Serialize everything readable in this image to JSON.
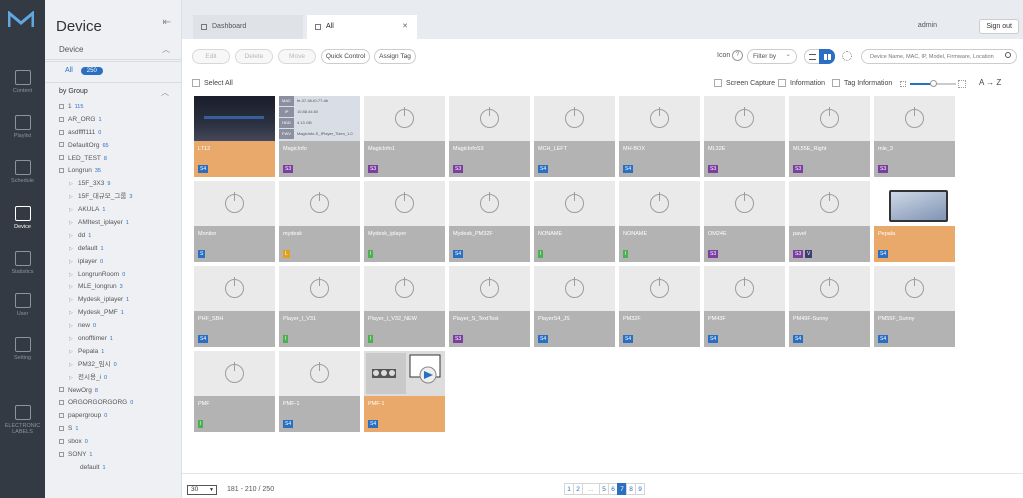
{
  "app": {
    "logo_text": "M"
  },
  "nav": [
    {
      "label": "Content",
      "icon": "content-icon"
    },
    {
      "label": "Playlist",
      "icon": "playlist-icon"
    },
    {
      "label": "Schedule",
      "icon": "schedule-icon"
    },
    {
      "label": "Device",
      "icon": "device-icon",
      "active": true
    },
    {
      "label": "Statistics",
      "icon": "statistics-icon"
    },
    {
      "label": "User",
      "icon": "user-icon"
    },
    {
      "label": "Setting",
      "icon": "setting-icon"
    },
    {
      "label": "ELECTRONIC LABELS",
      "icon": "electronic-labels-icon"
    }
  ],
  "sidebar": {
    "title": "Device",
    "section": "Device",
    "all_label": "All",
    "all_count": "250",
    "by_group": "by Group",
    "tree": [
      {
        "name": "1",
        "count": "115",
        "level": 0
      },
      {
        "name": "AR_ORG",
        "count": "1",
        "level": 0
      },
      {
        "name": "asdffff111",
        "count": "0",
        "level": 0
      },
      {
        "name": "DefaultOrg",
        "count": "65",
        "level": 0
      },
      {
        "name": "LED_TEST",
        "count": "8",
        "level": 0
      },
      {
        "name": "Longrun",
        "count": "35",
        "level": 0
      },
      {
        "name": "15F_3X3",
        "count": "9",
        "level": 1
      },
      {
        "name": "15F_대규모_그룹",
        "count": "3",
        "level": 1
      },
      {
        "name": "AKULA",
        "count": "1",
        "level": 1
      },
      {
        "name": "AMItest_iplayer",
        "count": "1",
        "level": 1
      },
      {
        "name": "dd",
        "count": "1",
        "level": 1
      },
      {
        "name": "default",
        "count": "1",
        "level": 1
      },
      {
        "name": "iplayer",
        "count": "0",
        "level": 1
      },
      {
        "name": "LongrunRoom",
        "count": "0",
        "level": 1
      },
      {
        "name": "MLE_longrun",
        "count": "3",
        "level": 1
      },
      {
        "name": "Mydesk_iplayer",
        "count": "1",
        "level": 1
      },
      {
        "name": "Mydesk_PMF",
        "count": "1",
        "level": 1
      },
      {
        "name": "new",
        "count": "0",
        "level": 1
      },
      {
        "name": "onofftimer",
        "count": "1",
        "level": 1
      },
      {
        "name": "Pepala",
        "count": "1",
        "level": 1
      },
      {
        "name": "PM32_임시",
        "count": "0",
        "level": 1
      },
      {
        "name": "전시용_i",
        "count": "0",
        "level": 1
      },
      {
        "name": "NewOrg",
        "count": "8",
        "level": 0
      },
      {
        "name": "ORGORGORGORG",
        "count": "0",
        "level": 0
      },
      {
        "name": "papergroup",
        "count": "0",
        "level": 0
      },
      {
        "name": "S",
        "count": "1",
        "level": 0
      },
      {
        "name": "sbox",
        "count": "0",
        "level": 0
      },
      {
        "name": "SONY",
        "count": "1",
        "level": 0
      },
      {
        "name": "default",
        "count": "1",
        "level": 2
      }
    ]
  },
  "tabs": [
    {
      "label": "Dashboard"
    },
    {
      "label": "All"
    }
  ],
  "header": {
    "user": "admin",
    "signout": "Sign out"
  },
  "toolbar": {
    "edit": "Edit",
    "delete": "Delete",
    "move": "Move",
    "quick_control": "Quick Control",
    "assign_tag": "Assign Tag",
    "icon_label": "Icon",
    "help": "?",
    "filter": "Filter by",
    "search_placeholder": "Device Name, MAC, IP, Model, Firmware, Location"
  },
  "selectbar": {
    "select_all": "Select All",
    "screen_capture": "Screen Capture",
    "information": "Information",
    "tag_information": "Tag Information",
    "sort": "A → Z",
    "zoom_level": 0.5
  },
  "info_card": {
    "MAC": "fe-37-46-f0-77-db",
    "IP": "10.88.44.60",
    "HDD": "4.13 GB",
    "FWV": "MagicInfo-S_IPlayer_Tizen_1.0"
  },
  "devices": [
    {
      "name": "LT12",
      "tag": "S4",
      "tagcolor": "#2a6fc2",
      "sel": true,
      "thumb": "dark"
    },
    {
      "name": "MagicInfo",
      "tag": "S3",
      "tagcolor": "#7b3fa0",
      "thumb": "info"
    },
    {
      "name": "MagicInfo1",
      "tag": "S3",
      "tagcolor": "#7b3fa0"
    },
    {
      "name": "MagicInfoS3",
      "tag": "S3",
      "tagcolor": "#7b3fa0"
    },
    {
      "name": "MCH_LEFT",
      "tag": "S4",
      "tagcolor": "#2a6fc2"
    },
    {
      "name": "MH-BOX",
      "tag": "S4",
      "tagcolor": "#2a6fc2"
    },
    {
      "name": "ML32E",
      "tag": "S3",
      "tagcolor": "#7b3fa0"
    },
    {
      "name": "ML55E_Right",
      "tag": "S3",
      "tagcolor": "#7b3fa0"
    },
    {
      "name": "mle_3",
      "tag": "S3",
      "tagcolor": "#7b3fa0"
    },
    {
      "name": "Monitor",
      "tag": "S",
      "tagcolor": "#2a6fc2"
    },
    {
      "name": "mydesk",
      "tag": "L",
      "tagcolor": "#e0a020"
    },
    {
      "name": "Mydesk_iplayer",
      "tag": "I",
      "tagcolor": "#4caf50"
    },
    {
      "name": "Mydesk_PM32F",
      "tag": "S4",
      "tagcolor": "#2a6fc2"
    },
    {
      "name": "NONAME",
      "tag": "I",
      "tagcolor": "#4caf50"
    },
    {
      "name": "NONAME",
      "tag": "I",
      "tagcolor": "#4caf50"
    },
    {
      "name": "OM24E",
      "tag": "S3",
      "tagcolor": "#7b3fa0"
    },
    {
      "name": "pavel",
      "tag": "S3",
      "tagcolor": "#7b3fa0",
      "tag2": "V"
    },
    {
      "name": "Pepala",
      "tag": "S4",
      "tagcolor": "#2a6fc2",
      "sel": true,
      "thumb": "monitor"
    },
    {
      "name": "PHF_SBH",
      "tag": "S4",
      "tagcolor": "#2a6fc2"
    },
    {
      "name": "Player_I_V31",
      "tag": "I",
      "tagcolor": "#4caf50"
    },
    {
      "name": "Player_I_V32_NEW",
      "tag": "I",
      "tagcolor": "#4caf50"
    },
    {
      "name": "Player_S_TextTest",
      "tag": "S3",
      "tagcolor": "#7b3fa0"
    },
    {
      "name": "PlayerS4_JS",
      "tag": "S4",
      "tagcolor": "#2a6fc2"
    },
    {
      "name": "PM32F",
      "tag": "S4",
      "tagcolor": "#2a6fc2"
    },
    {
      "name": "PM43F",
      "tag": "S4",
      "tagcolor": "#2a6fc2"
    },
    {
      "name": "PM49F-Sunny",
      "tag": "S4",
      "tagcolor": "#2a6fc2"
    },
    {
      "name": "PM55F_Sunny",
      "tag": "S4",
      "tagcolor": "#2a6fc2"
    },
    {
      "name": "PMF",
      "tag": "I",
      "tagcolor": "#4caf50"
    },
    {
      "name": "PMF-1",
      "tag": "S4",
      "tagcolor": "#2a6fc2"
    },
    {
      "name": "PMF-1",
      "tag": "S4",
      "tagcolor": "#2a6fc2",
      "sel": true,
      "thumb": "pic"
    }
  ],
  "pager": {
    "per_page": "30",
    "range": "181 - 210 / 250",
    "pages": [
      "1",
      "2",
      "...",
      "5",
      "6",
      "7",
      "8",
      "9"
    ],
    "current": "7"
  },
  "colors": {
    "accent": "#2a6fc2",
    "selected": "#e8a96a",
    "nav_bg": "#333a44"
  }
}
